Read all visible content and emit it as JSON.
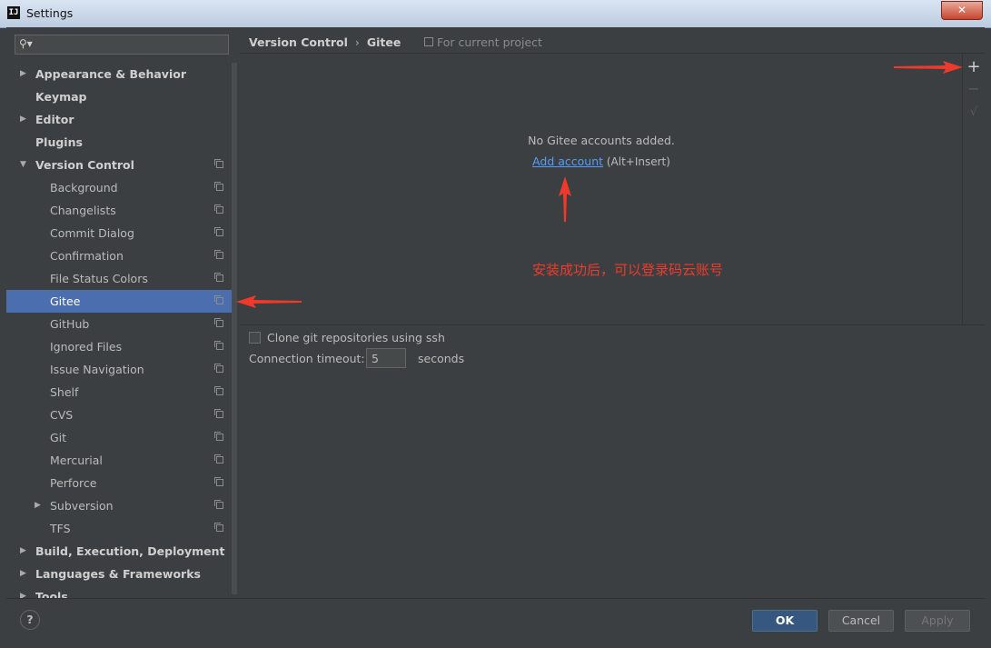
{
  "window": {
    "title": "Settings",
    "app_icon": "IJ"
  },
  "sidebar": {
    "search": {
      "value": ""
    },
    "items": [
      {
        "label": "Appearance & Behavior",
        "expandable": true,
        "expanded": false,
        "bold": true,
        "level": 0,
        "project": false
      },
      {
        "label": "Keymap",
        "expandable": false,
        "bold": true,
        "level": 0,
        "project": false
      },
      {
        "label": "Editor",
        "expandable": true,
        "expanded": false,
        "bold": true,
        "level": 0,
        "project": false
      },
      {
        "label": "Plugins",
        "expandable": false,
        "bold": true,
        "level": 0,
        "project": false
      },
      {
        "label": "Version Control",
        "expandable": true,
        "expanded": true,
        "bold": true,
        "level": 0,
        "project": true
      },
      {
        "label": "Background",
        "level": 1,
        "project": true
      },
      {
        "label": "Changelists",
        "level": 1,
        "project": true
      },
      {
        "label": "Commit Dialog",
        "level": 1,
        "project": true
      },
      {
        "label": "Confirmation",
        "level": 1,
        "project": true
      },
      {
        "label": "File Status Colors",
        "level": 1,
        "project": true
      },
      {
        "label": "Gitee",
        "level": 1,
        "project": true,
        "selected": true
      },
      {
        "label": "GitHub",
        "level": 1,
        "project": true
      },
      {
        "label": "Ignored Files",
        "level": 1,
        "project": true
      },
      {
        "label": "Issue Navigation",
        "level": 1,
        "project": true
      },
      {
        "label": "Shelf",
        "level": 1,
        "project": true
      },
      {
        "label": "CVS",
        "level": 1,
        "project": true
      },
      {
        "label": "Git",
        "level": 1,
        "project": true
      },
      {
        "label": "Mercurial",
        "level": 1,
        "project": true
      },
      {
        "label": "Perforce",
        "level": 1,
        "project": true
      },
      {
        "label": "Subversion",
        "level": 1,
        "project": true,
        "expandable": true,
        "expanded": false
      },
      {
        "label": "TFS",
        "level": 1,
        "project": true
      },
      {
        "label": "Build, Execution, Deployment",
        "expandable": true,
        "expanded": false,
        "bold": true,
        "level": 0,
        "project": false
      },
      {
        "label": "Languages & Frameworks",
        "expandable": true,
        "expanded": false,
        "bold": true,
        "level": 0,
        "project": false
      },
      {
        "label": "Tools",
        "expandable": true,
        "expanded": false,
        "bold": true,
        "level": 0,
        "project": false
      }
    ]
  },
  "main": {
    "breadcrumb": {
      "parent": "Version Control",
      "separator": "›",
      "current": "Gitee"
    },
    "for_project": "For current project",
    "accounts": {
      "empty_text": "No Gitee accounts added.",
      "add_link": "Add account",
      "add_shortcut": "(Alt+Insert)",
      "toolbar": {
        "add": "+",
        "remove": "−",
        "default": "√"
      }
    },
    "annotation": "安装成功后，可以登录码云账号",
    "clone_ssh": {
      "label": "Clone git repositories using ssh",
      "checked": false
    },
    "timeout": {
      "label": "Connection timeout:",
      "value": "5",
      "unit": "seconds"
    }
  },
  "footer": {
    "help": "?",
    "ok": "OK",
    "cancel": "Cancel",
    "apply": "Apply"
  },
  "colors": {
    "background": "#3c3f41",
    "selection": "#4b6eaf",
    "link": "#589df6",
    "annotation": "#ee3a2a",
    "ok_button": "#365880"
  }
}
